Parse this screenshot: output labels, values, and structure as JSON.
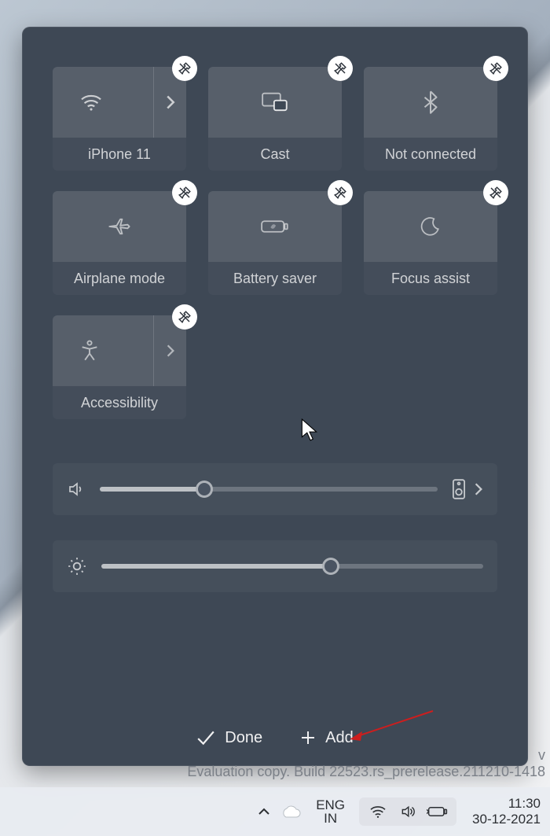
{
  "quick_settings": {
    "tiles": [
      {
        "id": "wifi",
        "label": "iPhone 11",
        "icon": "wifi-icon",
        "has_chevron": true
      },
      {
        "id": "cast",
        "label": "Cast",
        "icon": "cast-icon",
        "has_chevron": false
      },
      {
        "id": "bluetooth",
        "label": "Not connected",
        "icon": "bluetooth-icon",
        "has_chevron": false
      },
      {
        "id": "airplane",
        "label": "Airplane mode",
        "icon": "airplane-icon",
        "has_chevron": false
      },
      {
        "id": "battery-saver",
        "label": "Battery saver",
        "icon": "battery-saver-icon",
        "has_chevron": false
      },
      {
        "id": "focus-assist",
        "label": "Focus assist",
        "icon": "moon-icon",
        "has_chevron": false
      },
      {
        "id": "accessibility",
        "label": "Accessibility",
        "icon": "accessibility-icon",
        "has_chevron": true
      }
    ],
    "sliders": {
      "volume": {
        "value": 31,
        "output_icon": "speaker-device-icon",
        "has_chevron": true
      },
      "brightness": {
        "value": 60
      }
    },
    "footer": {
      "done_label": "Done",
      "add_label": "Add"
    }
  },
  "desktop": {
    "watermark_line1": "v",
    "watermark_line2": "Evaluation copy. Build 22523.rs_prerelease.211210-1418"
  },
  "taskbar": {
    "lang_primary": "ENG",
    "lang_secondary": "IN",
    "time": "11:30",
    "date": "30-12-2021"
  },
  "colors": {
    "panel_bg": "#3e4855",
    "tile_icon_bg": "rgba(255,255,255,0.10)",
    "text": "rgba(255,255,255,0.85)",
    "pin_bg": "#ffffff"
  }
}
